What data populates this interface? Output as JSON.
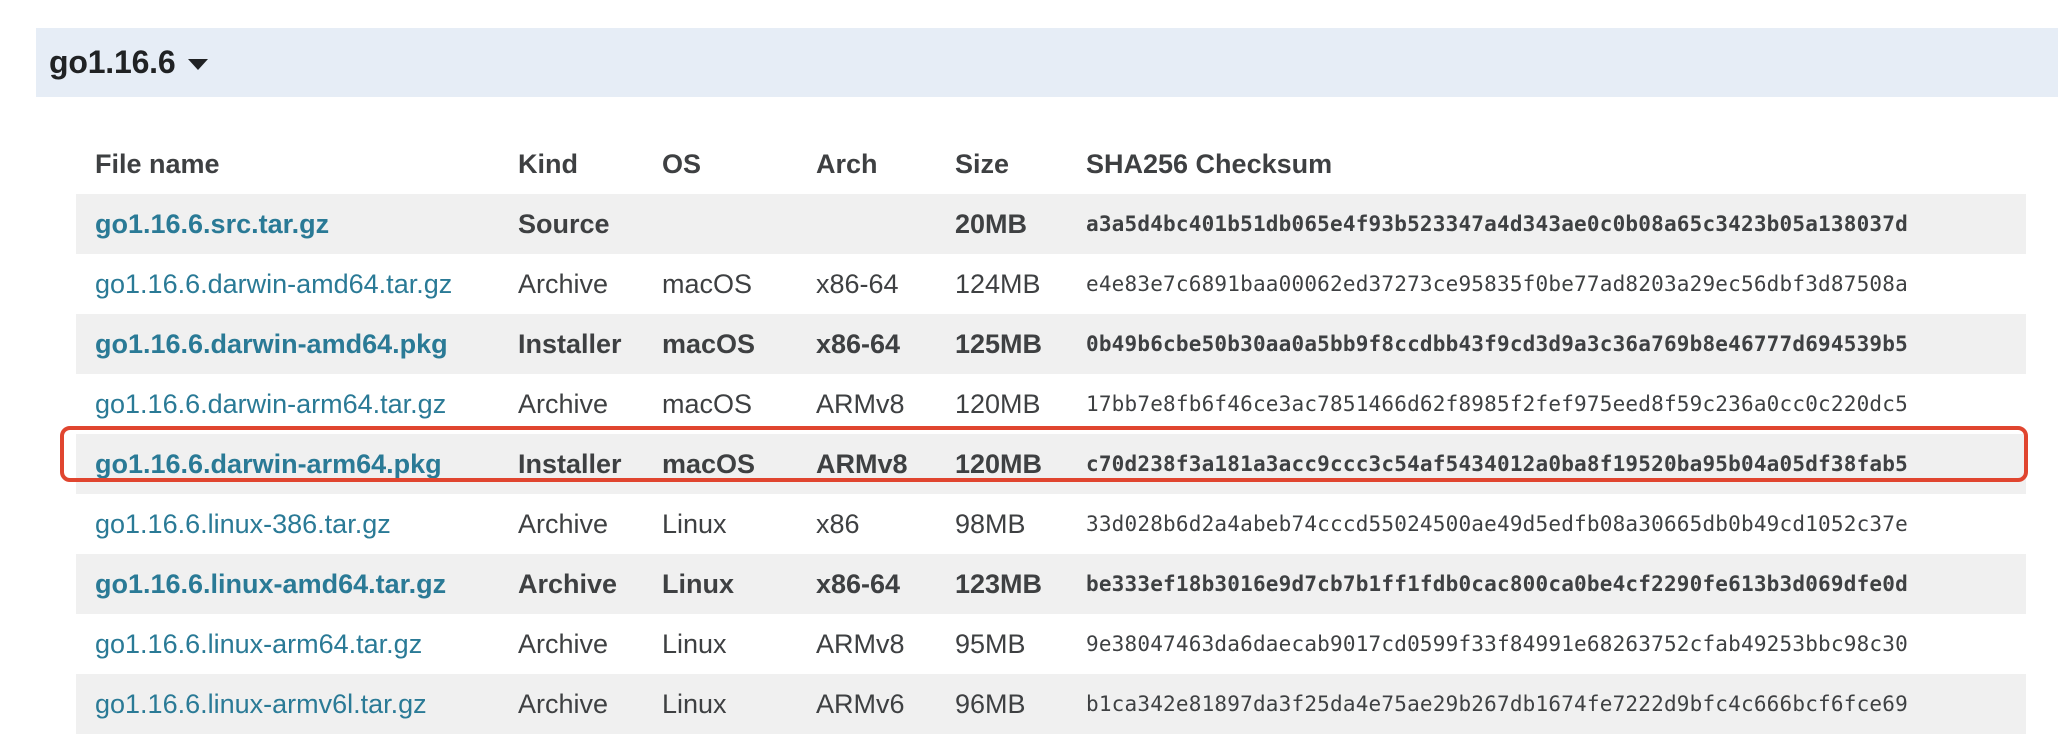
{
  "release": {
    "title": "go1.16.6",
    "toggle_icon": "chevron-down-icon"
  },
  "table": {
    "headers": {
      "file": "File name",
      "kind": "Kind",
      "os": "OS",
      "arch": "Arch",
      "size": "Size",
      "checksum": "SHA256 Checksum"
    },
    "rows": [
      {
        "file": "go1.16.6.src.tar.gz",
        "kind": "Source",
        "os": "",
        "arch": "",
        "size": "20MB",
        "checksum": "a3a5d4bc401b51db065e4f93b523347a4d343ae0c0b08a65c3423b05a138037d",
        "featured": true
      },
      {
        "file": "go1.16.6.darwin-amd64.tar.gz",
        "kind": "Archive",
        "os": "macOS",
        "arch": "x86-64",
        "size": "124MB",
        "checksum": "e4e83e7c6891baa00062ed37273ce95835f0be77ad8203a29ec56dbf3d87508a",
        "featured": false
      },
      {
        "file": "go1.16.6.darwin-amd64.pkg",
        "kind": "Installer",
        "os": "macOS",
        "arch": "x86-64",
        "size": "125MB",
        "checksum": "0b49b6cbe50b30aa0a5bb9f8ccdbb43f9cd3d9a3c36a769b8e46777d694539b5",
        "featured": true
      },
      {
        "file": "go1.16.6.darwin-arm64.tar.gz",
        "kind": "Archive",
        "os": "macOS",
        "arch": "ARMv8",
        "size": "120MB",
        "checksum": "17bb7e8fb6f46ce3ac7851466d62f8985f2fef975eed8f59c236a0cc0c220dc5",
        "featured": false
      },
      {
        "file": "go1.16.6.darwin-arm64.pkg",
        "kind": "Installer",
        "os": "macOS",
        "arch": "ARMv8",
        "size": "120MB",
        "checksum": "c70d238f3a181a3acc9ccc3c54af5434012a0ba8f19520ba95b04a05df38fab5",
        "featured": true
      },
      {
        "file": "go1.16.6.linux-386.tar.gz",
        "kind": "Archive",
        "os": "Linux",
        "arch": "x86",
        "size": "98MB",
        "checksum": "33d028b6d2a4abeb74cccd55024500ae49d5edfb08a30665db0b49cd1052c37e",
        "featured": false
      },
      {
        "file": "go1.16.6.linux-amd64.tar.gz",
        "kind": "Archive",
        "os": "Linux",
        "arch": "x86-64",
        "size": "123MB",
        "checksum": "be333ef18b3016e9d7cb7b1ff1fdb0cac800ca0be4cf2290fe613b3d069dfe0d",
        "featured": true
      },
      {
        "file": "go1.16.6.linux-arm64.tar.gz",
        "kind": "Archive",
        "os": "Linux",
        "arch": "ARMv8",
        "size": "95MB",
        "checksum": "9e38047463da6daecab9017cd0599f33f84991e68263752cfab49253bbc98c30",
        "featured": false
      },
      {
        "file": "go1.16.6.linux-armv6l.tar.gz",
        "kind": "Archive",
        "os": "Linux",
        "arch": "ARMv6",
        "size": "96MB",
        "checksum": "b1ca342e81897da3f25da4e75ae29b267db1674fe7222d9bfc4c666bcf6fce69",
        "featured": false
      }
    ]
  },
  "colors": {
    "header_bg": "#e6edf6",
    "link": "#2a7a96",
    "stripe": "#f0f0f0",
    "highlight": "#e0452f"
  }
}
